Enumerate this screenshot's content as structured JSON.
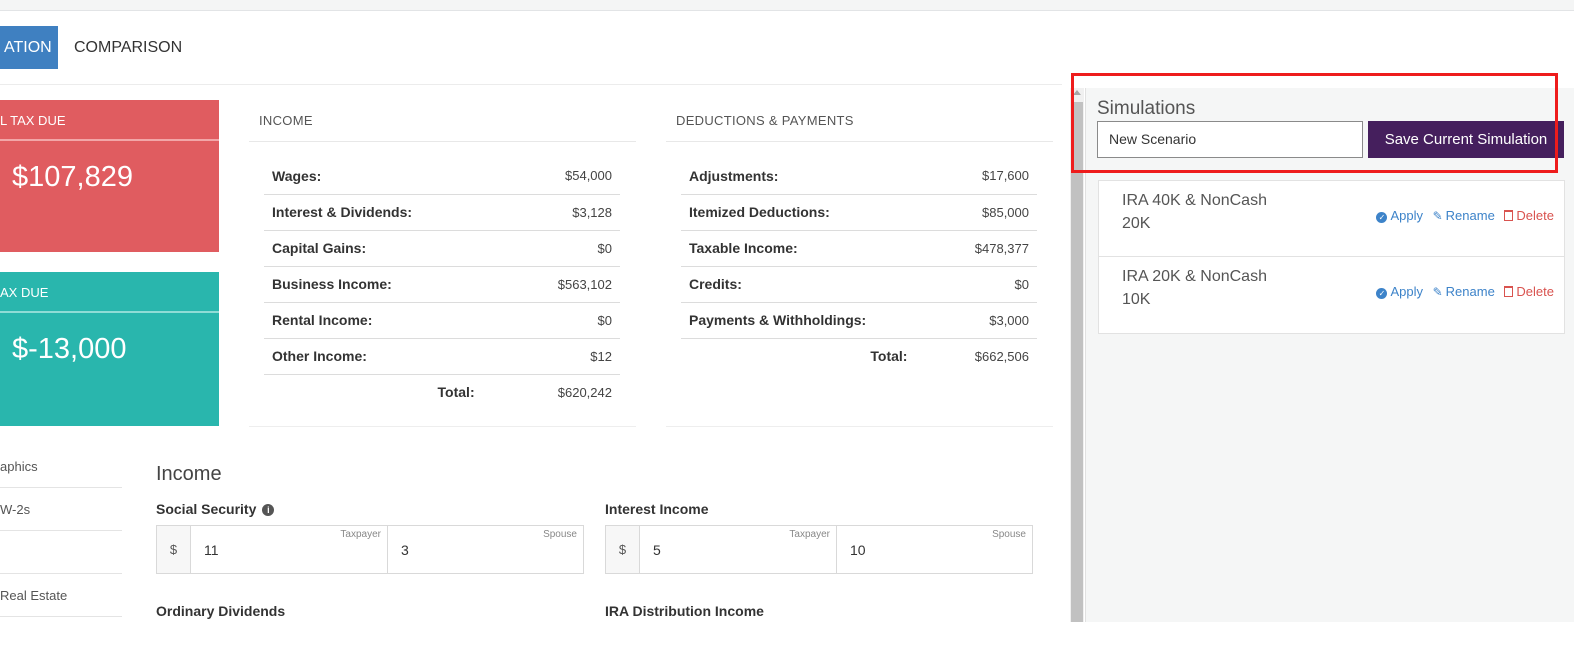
{
  "tabs": {
    "active": "ATION",
    "other": "COMPARISON"
  },
  "cards": {
    "total_tax": {
      "label": "L TAX DUE",
      "value": "$107,829"
    },
    "tax_due": {
      "label": "AX DUE",
      "value": "$-13,000"
    }
  },
  "left_nav": [
    "aphics",
    "W-2s",
    "",
    "Real Estate",
    ""
  ],
  "income_summary": {
    "title": "INCOME",
    "rows": [
      {
        "label": "Wages:",
        "value": "$54,000"
      },
      {
        "label": "Interest & Dividends:",
        "value": "$3,128"
      },
      {
        "label": "Capital Gains:",
        "value": "$0"
      },
      {
        "label": "Business Income:",
        "value": "$563,102"
      },
      {
        "label": "Rental Income:",
        "value": "$0"
      },
      {
        "label": "Other Income:",
        "value": "$12"
      }
    ],
    "total_label": "Total:",
    "total_value": "$620,242"
  },
  "deductions_summary": {
    "title": "DEDUCTIONS & PAYMENTS",
    "rows": [
      {
        "label": "Adjustments:",
        "value": "$17,600"
      },
      {
        "label": "Itemized Deductions:",
        "value": "$85,000"
      },
      {
        "label": "Taxable Income:",
        "value": "$478,377"
      },
      {
        "label": "Credits:",
        "value": "$0"
      },
      {
        "label": "Payments & Withholdings:",
        "value": "$3,000"
      }
    ],
    "total_label": "Total:",
    "total_value": "$662,506"
  },
  "income_form": {
    "title": "Income",
    "social_security": {
      "label": "Social Security",
      "currency": "$",
      "taxpayer_caption": "Taxpayer",
      "taxpayer": "11",
      "spouse_caption": "Spouse",
      "spouse": "3",
      "info": "i"
    },
    "interest_income": {
      "label": "Interest Income",
      "currency": "$",
      "taxpayer_caption": "Taxpayer",
      "taxpayer": "5",
      "spouse_caption": "Spouse",
      "spouse": "10"
    },
    "ordinary_dividends": {
      "label": "Ordinary Dividends"
    },
    "ira_distribution": {
      "label": "IRA Distribution Income"
    }
  },
  "simulations": {
    "title": "Simulations",
    "input_value": "New Scenario",
    "save_label": "Save Current Simulation",
    "items": [
      {
        "name": "IRA 40K & NonCash 20K",
        "apply": "Apply",
        "rename": "Rename",
        "delete": "Delete"
      },
      {
        "name": "IRA 20K & NonCash 10K",
        "apply": "Apply",
        "rename": "Rename",
        "delete": "Delete"
      }
    ]
  },
  "colors": {
    "tab_active": "#3f80c1",
    "card_red": "#e05c60",
    "card_teal": "#29b6ad",
    "save_button": "#451f5d",
    "link_blue": "#3d83c9",
    "delete_red": "#d9534f",
    "highlight": "#ee1c1c"
  }
}
